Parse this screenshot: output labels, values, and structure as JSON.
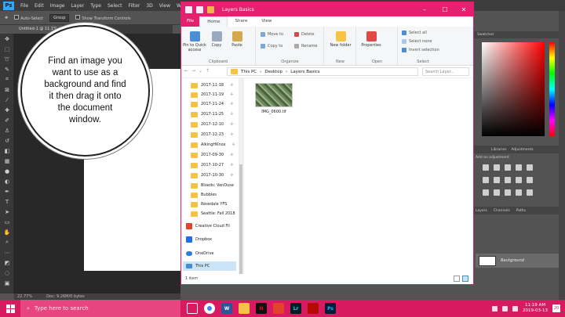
{
  "photoshop": {
    "logo": "Ps",
    "menu": [
      "File",
      "Edit",
      "Image",
      "Layer",
      "Type",
      "Select",
      "Filter",
      "3D",
      "View",
      "Window"
    ],
    "options": {
      "auto_select_label": "Auto-Select",
      "auto_select_value": "Group",
      "show_transform_label": "Show Transform Controls"
    },
    "doc_tab": "Untitled-1 @ 11.1%",
    "status": {
      "zoom": "22.77%",
      "doc": "Doc: 9.26M/0 bytes"
    },
    "panels": {
      "top_tabs": [
        "Swatches"
      ],
      "adjust_tabs": [
        "Libraries",
        "Adjustments"
      ],
      "adjust_sub": "Add an adjustment",
      "layer_tabs": [
        "Layers",
        "Channels",
        "Paths"
      ],
      "layer_name": "Background"
    }
  },
  "callout": {
    "text": "Find an image you want to use as a background and find it then drag it onto the document window."
  },
  "explorer": {
    "title": "Layers Basics",
    "tabs": {
      "file": "File",
      "home": "Home",
      "share": "Share",
      "view": "View"
    },
    "ribbon": {
      "clipboard": {
        "label": "Clipboard",
        "pin": "Pin to Quick access",
        "copy": "Copy",
        "paste": "Paste"
      },
      "organize": {
        "label": "Organize",
        "move_to": "Move to",
        "delete": "Delete",
        "copy_to": "Copy to",
        "rename": "Rename"
      },
      "new": {
        "label": "New",
        "new_folder": "New folder"
      },
      "open": {
        "label": "Open",
        "properties": "Properties"
      },
      "select": {
        "label": "Select",
        "select_all": "Select all",
        "select_none": "Select none",
        "invert": "Invert selection"
      }
    },
    "path": [
      "This PC",
      "Desktop",
      "Layers Basics"
    ],
    "search_placeholder": "Search Layer...",
    "nav_items": [
      "2017-11-18",
      "2017-11-19",
      "2017-11-24",
      "2017-11-25",
      "2017-12-10",
      "2017-12-23",
      "AlkingHKnox",
      "2017-09-30",
      "2017-10-27",
      "2017-10-30",
      "Bloeds: VanDuse",
      "Bubbles",
      "Rosedale YFS",
      "Seattle: Fall 2018"
    ],
    "nav_special": {
      "creative_cloud": "Creative Cloud Fil",
      "dropbox": "Dropbox",
      "onedrive": "OneDrive",
      "this_pc": "This PC"
    },
    "file": {
      "name": "IMG_0600.tif"
    },
    "status": "1 item"
  },
  "taskbar": {
    "search_placeholder": "Type here to search",
    "clock_time": "11:19 AM",
    "clock_date": "2019-03-13",
    "notif_count": "20",
    "apps": [
      "Ch",
      "W",
      "Ex",
      "N",
      "Cl",
      "Lr",
      "Ac",
      "Ps"
    ]
  },
  "colors": {
    "taskbar": "#d81b60",
    "explorer_accent": "#e61f6e",
    "ps_dark": "#3c3c3c"
  }
}
